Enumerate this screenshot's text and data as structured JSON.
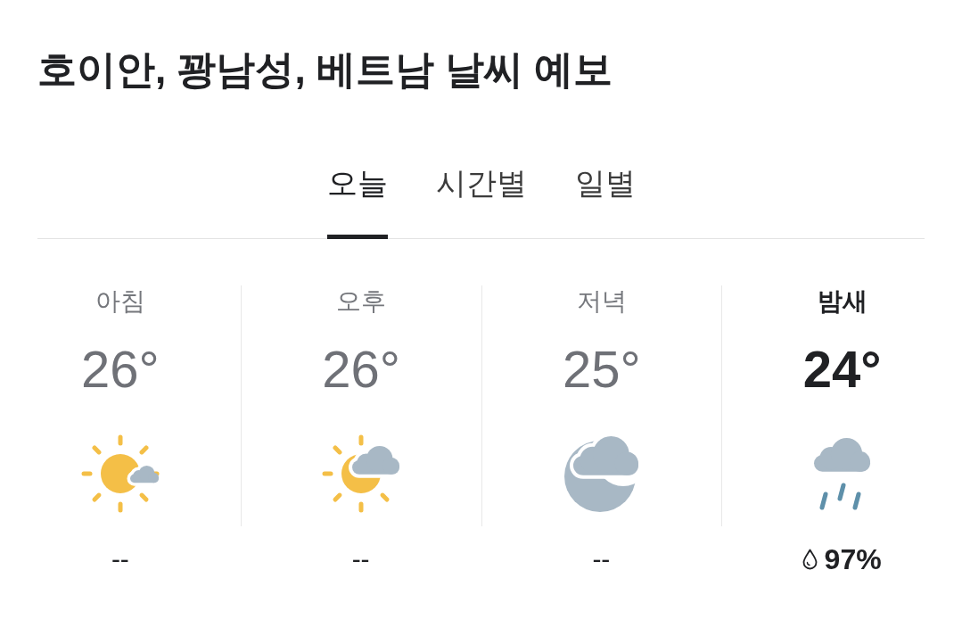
{
  "title": "호이안, 꽝남성, 베트남 날씨 예보",
  "tabs": [
    {
      "label": "오늘",
      "selected": true
    },
    {
      "label": "시간별",
      "selected": false
    },
    {
      "label": "일별",
      "selected": false
    }
  ],
  "periods": [
    {
      "label": "아침",
      "temperature": "26°",
      "kind": "sunny_few_clouds",
      "precipitation": {
        "kind": "none",
        "text": "--"
      },
      "selected": false
    },
    {
      "label": "오후",
      "temperature": "26°",
      "kind": "partly_cloudy_day",
      "precipitation": {
        "kind": "none",
        "text": "--"
      },
      "selected": false
    },
    {
      "label": "저녁",
      "temperature": "25°",
      "kind": "partly_cloudy_night",
      "precipitation": {
        "kind": "none",
        "text": "--"
      },
      "selected": false
    },
    {
      "label": "밤새",
      "temperature": "24°",
      "kind": "rain",
      "precipitation": {
        "kind": "chance",
        "text": "97%"
      },
      "selected": true
    }
  ]
}
